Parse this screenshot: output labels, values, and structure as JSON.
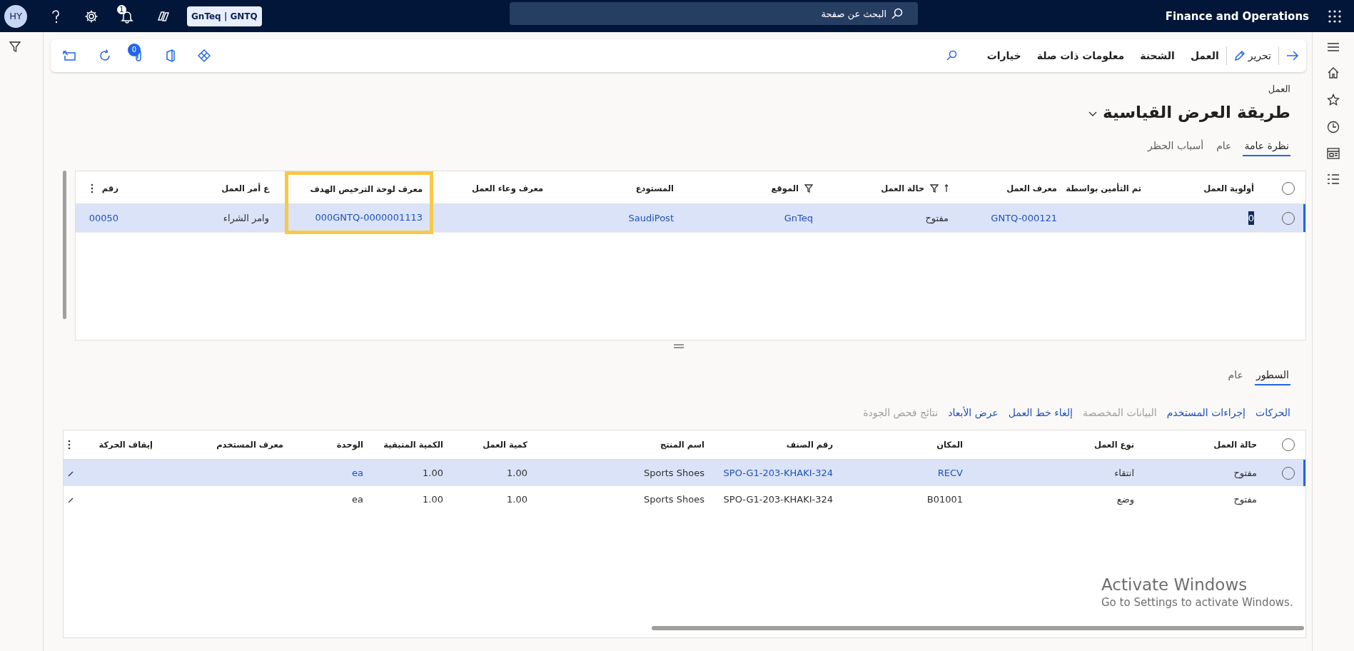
{
  "top_bar": {
    "avatar": "HY",
    "notification_count": "1",
    "company": "GnTeq | GNTQ",
    "search": {
      "placeholder": "البحث عن صفحة"
    },
    "app_title": "Finance and Operations"
  },
  "action_pane": {
    "edit": "تحرير",
    "menus": [
      "العمل",
      "الشحنة",
      "معلومات ذات صلة",
      "خيارات"
    ],
    "attachment_count": "0"
  },
  "breadcrumb": "العمل",
  "view_title": "طريقة العرض القياسية",
  "header_tabs": [
    {
      "label": "نظرة عامة",
      "selected": true
    },
    {
      "label": "عام",
      "selected": false
    },
    {
      "label": "أسباب الحظر",
      "selected": false
    }
  ],
  "work_grid": {
    "columns": [
      {
        "label": "أولوية العمل",
        "kind": "input",
        "filtered": false,
        "sorted": false,
        "highlighted": false
      },
      {
        "label": "تم التأمين بواسطة",
        "kind": "text",
        "filtered": false,
        "sorted": false,
        "highlighted": false
      },
      {
        "label": "معرف العمل",
        "kind": "link",
        "filtered": false,
        "sorted": false,
        "highlighted": false
      },
      {
        "label": "حالة العمل",
        "kind": "text",
        "filtered": true,
        "sorted": true,
        "highlighted": false
      },
      {
        "label": "الموقع",
        "kind": "link",
        "filtered": true,
        "sorted": false,
        "highlighted": false
      },
      {
        "label": "المستودع",
        "kind": "link",
        "filtered": false,
        "sorted": false,
        "highlighted": false
      },
      {
        "label": "معرف وعاء العمل",
        "kind": "link",
        "filtered": false,
        "sorted": false,
        "highlighted": false
      },
      {
        "label": "معرف لوحة الترخيص الهدف",
        "kind": "link",
        "filtered": false,
        "sorted": false,
        "highlighted": true
      },
      {
        "label": "ع أمر العمل",
        "kind": "text",
        "filtered": false,
        "sorted": false,
        "highlighted": false
      },
      {
        "label": "رقم",
        "kind": "link",
        "filtered": false,
        "sorted": false,
        "highlighted": false
      }
    ],
    "rows": [
      {
        "selected": true,
        "cells": [
          "0",
          "",
          "GNTQ-000121",
          "مفتوح",
          "GnTeq",
          "SaudiPost",
          "",
          "000GNTQ-0000001113",
          "وامر الشراء",
          "00050"
        ]
      }
    ]
  },
  "line_tabs": [
    {
      "label": "السطور",
      "selected": true
    },
    {
      "label": "عام",
      "selected": false
    }
  ],
  "line_actions": [
    {
      "label": "الحركات",
      "disabled": false
    },
    {
      "label": "إجراءات المستخدم",
      "disabled": false
    },
    {
      "label": "البيانات المخصصة",
      "disabled": true
    },
    {
      "label": "إلغاء خط العمل",
      "disabled": false
    },
    {
      "label": "عرض الأبعاد",
      "disabled": false
    },
    {
      "label": "نتائج فحص الجودة",
      "disabled": true
    }
  ],
  "lines_grid": {
    "columns": [
      {
        "label": "حالة العمل",
        "kind": "text"
      },
      {
        "label": "نوع العمل",
        "kind": "text"
      },
      {
        "label": "المكان",
        "kind": "link"
      },
      {
        "label": "رقم الصنف",
        "kind": "link"
      },
      {
        "label": "اسم المنتج",
        "kind": "text"
      },
      {
        "label": "كمية العمل",
        "kind": "text"
      },
      {
        "label": "الكمية المتبقية",
        "kind": "text"
      },
      {
        "label": "الوحدة",
        "kind": "link"
      },
      {
        "label": "معرف المستخدم",
        "kind": "text"
      },
      {
        "label": "إيقاف الحركة",
        "kind": "text"
      },
      {
        "kind": "check"
      }
    ],
    "rows": [
      {
        "selected": true,
        "cells": [
          "مفتوح",
          "انتقاء",
          "RECV",
          "SPO-G1-203-KHAKI-324",
          "Sports Shoes",
          "1.00",
          "1.00",
          "ea",
          "",
          "",
          true
        ]
      },
      {
        "selected": false,
        "cells": [
          "مفتوح",
          "وضع",
          "B01001",
          "SPO-G1-203-KHAKI-324",
          "Sports Shoes",
          "1.00",
          "1.00",
          "ea",
          "",
          "",
          true
        ]
      }
    ]
  },
  "os_notice": {
    "title": "Activate Windows",
    "text": "Go to Settings to activate Windows."
  }
}
